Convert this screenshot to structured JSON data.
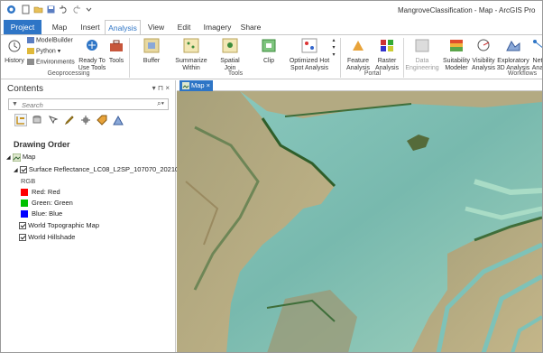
{
  "window": {
    "title": "MangroveClassification - Map - ArcGIS Pro"
  },
  "tabs": [
    "Project",
    "Map",
    "Insert",
    "Analysis",
    "View",
    "Edit",
    "Imagery",
    "Share"
  ],
  "ribbon": {
    "geoprocessing": {
      "label": "Geoprocessing",
      "history": "History",
      "modelbuilder": "ModelBuilder",
      "python": "Python",
      "environments": "Environments",
      "ready_to_use": [
        "Ready To",
        "Use Tools"
      ],
      "tools": "Tools"
    },
    "tools_group": {
      "label": "Tools",
      "buffer": "Buffer",
      "summarize": [
        "Summarize",
        "Within"
      ],
      "spatial_join": [
        "Spatial",
        "Join"
      ],
      "clip": "Clip",
      "hotspot": [
        "Optimized Hot",
        "Spot Analysis"
      ]
    },
    "portal": {
      "label": "Portal",
      "feature": [
        "Feature",
        "Analysis"
      ],
      "raster": [
        "Raster",
        "Analysis"
      ]
    },
    "workflows": {
      "label": "Workflows",
      "data_eng": [
        "Data",
        "Engineering"
      ],
      "suitability": [
        "Suitability",
        "Modeler"
      ],
      "visibility": [
        "Visibility",
        "Analysis"
      ],
      "exploratory": [
        "Exploratory",
        "3D Analysis"
      ],
      "network": [
        "Net",
        "Ana"
      ]
    }
  },
  "contents": {
    "title": "Contents",
    "controls": "▾ ⊓ ×",
    "search_placeholder": "Search",
    "drawing_order": "Drawing Order",
    "map_label": "Map",
    "layer_name": "Surface Reflectance_LC08_L2SP_107070_20210502_20210",
    "rgb_label": "RGB",
    "bands": [
      {
        "label": "Red:  Red",
        "color": "#ff0000"
      },
      {
        "label": "Green: Green",
        "color": "#00c000"
      },
      {
        "label": "Blue:  Blue",
        "color": "#0000ff"
      }
    ],
    "basemaps": [
      "World Topographic Map",
      "World Hillshade"
    ]
  },
  "map_view": {
    "tab_label": "Map",
    "tab_close": "×"
  },
  "colors": {
    "accent": "#2e75c6",
    "water": "#7ec2b8",
    "land": "#b9ab82"
  }
}
